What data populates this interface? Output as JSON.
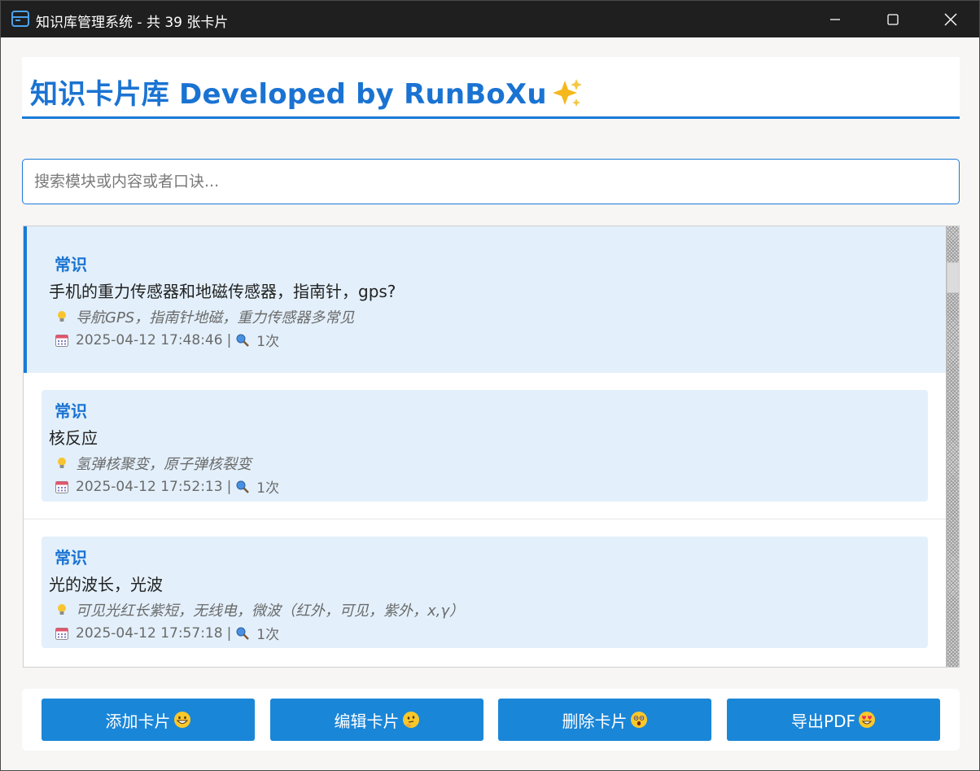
{
  "window": {
    "title": "知识库管理系统 - 共 39 张卡片"
  },
  "header": {
    "title": "知识卡片库 Developed by RunBoXu",
    "title_emoji": "sparkles-icon"
  },
  "search": {
    "placeholder": "搜索模块或内容或者口诀...",
    "value": ""
  },
  "cards": [
    {
      "module": "常识",
      "question": "手机的重力传感器和地磁传感器，指南针，gps?",
      "hint": "导航GPS，指南针地磁，重力传感器多常见",
      "date": "2025-04-12 17:48:46",
      "views": "1次",
      "selected": true
    },
    {
      "module": "常识",
      "question": "核反应",
      "hint": "氢弹核聚变，原子弹核裂变",
      "date": "2025-04-12 17:52:13",
      "views": "1次",
      "selected": false
    },
    {
      "module": "常识",
      "question": "光的波长，光波",
      "hint": "可见光红长紫短，无线电，微波（红外，可见，紫外，x,γ）",
      "date": "2025-04-12 17:57:18",
      "views": "1次",
      "selected": false
    }
  ],
  "meta_separator": "|",
  "buttons": {
    "add": "添加卡片",
    "edit": "编辑卡片",
    "delete": "删除卡片",
    "export": "导出PDF"
  },
  "colors": {
    "accent": "#1a7ad8",
    "selected_bg": "#e3f0fb",
    "button": "#1a86d8",
    "titlebar": "#1f1f1f"
  }
}
